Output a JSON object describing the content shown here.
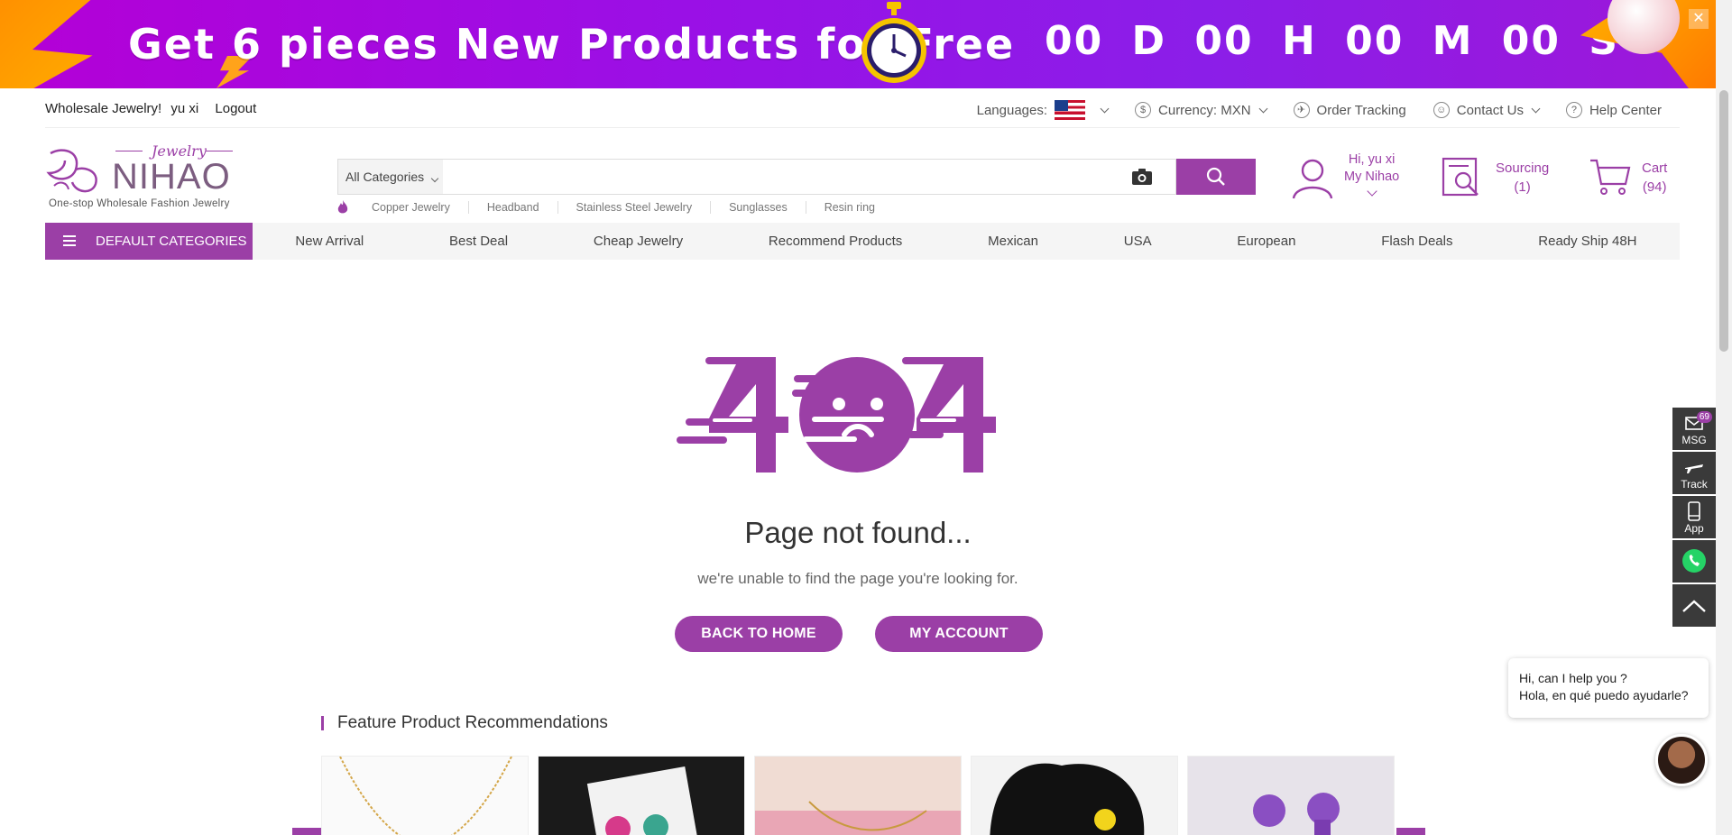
{
  "banner": {
    "title": "Get 6 pieces New Products for Free",
    "countdown": "00 D 00 H 00 M 00 S",
    "close": "✕"
  },
  "topbar": {
    "greeting": "Wholesale Jewelry!",
    "user": "yu xi",
    "logout": "Logout",
    "languages_label": "Languages:",
    "currency": "Currency: MXN",
    "order_tracking": "Order Tracking",
    "contact_us": "Contact Us",
    "help_center": "Help Center"
  },
  "logo": {
    "script": "Jewelry",
    "name": "NIHAO",
    "tagline": "One-stop Wholesale Fashion Jewelry"
  },
  "search": {
    "category": "All Categories",
    "placeholder": "",
    "hot_keywords": [
      "Copper Jewelry",
      "Headband",
      "Stainless Steel Jewelry",
      "Sunglasses",
      "Resin ring"
    ]
  },
  "account": {
    "hi": "Hi, yu xi",
    "my": "My Nihao"
  },
  "sourcing": {
    "label": "Sourcing",
    "count": "(1)"
  },
  "cart": {
    "label": "Cart",
    "count": "(94)"
  },
  "nav": {
    "categories": "DEFAULT CATEGORIES",
    "links": [
      "New Arrival",
      "Best Deal",
      "Cheap Jewelry",
      "Recommend Products",
      "Mexican",
      "USA",
      "European",
      "Flash Deals",
      "Ready Ship 48H"
    ]
  },
  "error": {
    "code": "404",
    "title": "Page not found...",
    "message": "we're unable to find the page you're looking for.",
    "back_home": "BACK TO HOME",
    "my_account": "MY ACCOUNT"
  },
  "recommendations": {
    "title": "Feature Product Recommendations"
  },
  "sidebar": {
    "msg": "MSG",
    "msg_badge": "69",
    "track": "Track",
    "app": "App"
  },
  "chat": {
    "line1": "Hi, can I help you ?",
    "line2": "Hola, en qué puedo ayudarle?"
  },
  "colors": {
    "brand": "#9b3fa6",
    "banner": "#9a10e6",
    "accent": "#ff9a00"
  }
}
